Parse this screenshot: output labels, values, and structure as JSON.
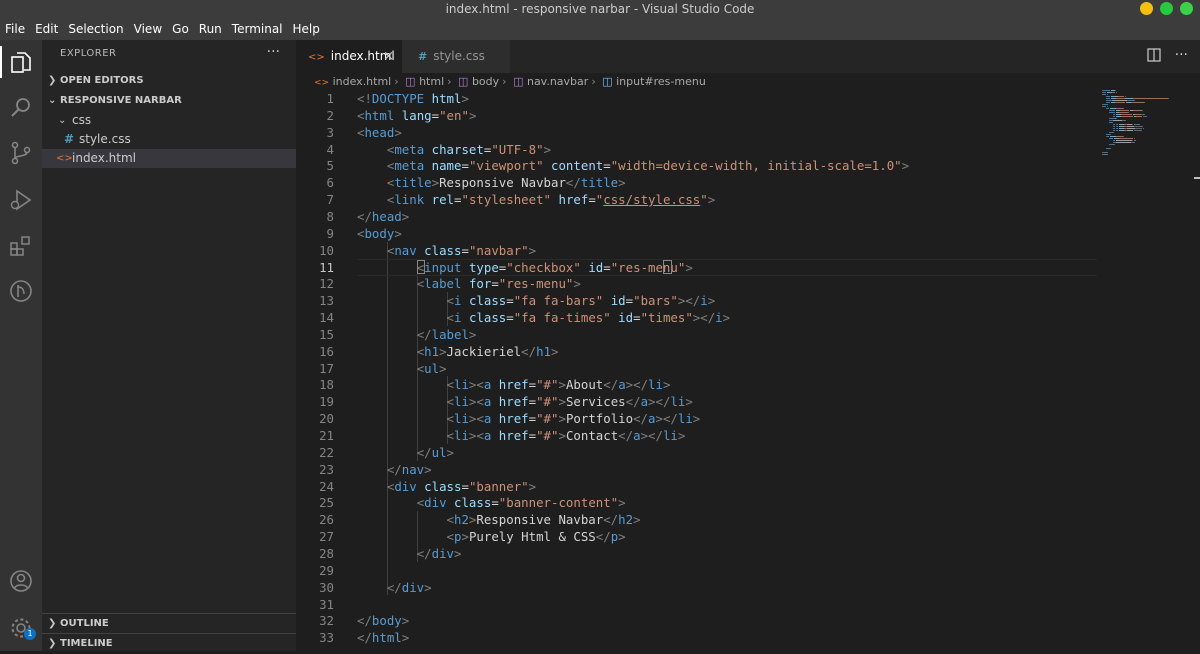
{
  "window": {
    "title": "index.html - responsive narbar - Visual Studio Code"
  },
  "menu": [
    "File",
    "Edit",
    "Selection",
    "View",
    "Go",
    "Run",
    "Terminal",
    "Help"
  ],
  "activity_icons": [
    "explorer-icon",
    "search-icon",
    "source-control-icon",
    "run-debug-icon",
    "extensions-icon",
    "remote-icon",
    "account-icon",
    "settings-gear-icon"
  ],
  "settings_badge": "1",
  "sidebar": {
    "header": "EXPLORER",
    "more": "···",
    "open_editors": "OPEN EDITORS",
    "project": "RESPONSIVE NARBAR",
    "folder": "css",
    "files": [
      "style.css",
      "index.html"
    ],
    "file_icons": [
      "#",
      "<>"
    ],
    "outline": "OUTLINE",
    "timeline": "TIMELINE"
  },
  "tabs": [
    {
      "label": "index.html",
      "icon": "<>",
      "active": true,
      "close": "×"
    },
    {
      "label": "style.css",
      "icon": "#",
      "active": false
    }
  ],
  "breadcrumbs": [
    "index.html",
    "html",
    "body",
    "nav.navbar",
    "input#res-menu"
  ],
  "editor": {
    "active_line": 11,
    "lines": [
      [
        [
          "p",
          "<!"
        ],
        [
          "t",
          "DOCTYPE"
        ],
        [
          "x",
          " "
        ],
        [
          "a",
          "html"
        ],
        [
          "p",
          ">"
        ]
      ],
      [
        [
          "p",
          "<"
        ],
        [
          "t",
          "html"
        ],
        [
          "x",
          " "
        ],
        [
          "a",
          "lang"
        ],
        [
          "x",
          "="
        ],
        [
          "s",
          "\"en\""
        ],
        [
          "p",
          ">"
        ]
      ],
      [
        [
          "p",
          "<"
        ],
        [
          "t",
          "head"
        ],
        [
          "p",
          ">"
        ]
      ],
      [
        [
          "x",
          "    "
        ],
        [
          "p",
          "<"
        ],
        [
          "t",
          "meta"
        ],
        [
          "x",
          " "
        ],
        [
          "a",
          "charset"
        ],
        [
          "x",
          "="
        ],
        [
          "s",
          "\"UTF-8\""
        ],
        [
          "p",
          ">"
        ]
      ],
      [
        [
          "x",
          "    "
        ],
        [
          "p",
          "<"
        ],
        [
          "t",
          "meta"
        ],
        [
          "x",
          " "
        ],
        [
          "a",
          "name"
        ],
        [
          "x",
          "="
        ],
        [
          "s",
          "\"viewport\""
        ],
        [
          "x",
          " "
        ],
        [
          "a",
          "content"
        ],
        [
          "x",
          "="
        ],
        [
          "s",
          "\"width=device-width, initial-scale=1.0\""
        ],
        [
          "p",
          ">"
        ]
      ],
      [
        [
          "x",
          "    "
        ],
        [
          "p",
          "<"
        ],
        [
          "t",
          "title"
        ],
        [
          "p",
          ">"
        ],
        [
          "x",
          "Responsive Navbar"
        ],
        [
          "p",
          "</"
        ],
        [
          "t",
          "title"
        ],
        [
          "p",
          ">"
        ]
      ],
      [
        [
          "x",
          "    "
        ],
        [
          "p",
          "<"
        ],
        [
          "t",
          "link"
        ],
        [
          "x",
          " "
        ],
        [
          "a",
          "rel"
        ],
        [
          "x",
          "="
        ],
        [
          "s",
          "\"stylesheet\""
        ],
        [
          "x",
          " "
        ],
        [
          "a",
          "href"
        ],
        [
          "x",
          "="
        ],
        [
          "s",
          "\""
        ],
        [
          "l",
          "css/style.css"
        ],
        [
          "s",
          "\""
        ],
        [
          "p",
          ">"
        ]
      ],
      [
        [
          "p",
          "</"
        ],
        [
          "t",
          "head"
        ],
        [
          "p",
          ">"
        ]
      ],
      [
        [
          "p",
          "<"
        ],
        [
          "t",
          "body"
        ],
        [
          "p",
          ">"
        ]
      ],
      [
        [
          "x",
          "    "
        ],
        [
          "p",
          "<"
        ],
        [
          "t",
          "nav"
        ],
        [
          "x",
          " "
        ],
        [
          "a",
          "class"
        ],
        [
          "x",
          "="
        ],
        [
          "s",
          "\"navbar\""
        ],
        [
          "p",
          ">"
        ]
      ],
      [
        [
          "x",
          "        "
        ],
        [
          "p",
          "<"
        ],
        [
          "t",
          "input"
        ],
        [
          "x",
          " "
        ],
        [
          "a",
          "type"
        ],
        [
          "x",
          "="
        ],
        [
          "s",
          "\"checkbox\""
        ],
        [
          "x",
          " "
        ],
        [
          "a",
          "id"
        ],
        [
          "x",
          "="
        ],
        [
          "s",
          "\"res-menu\""
        ],
        [
          "p",
          ">"
        ]
      ],
      [
        [
          "x",
          "        "
        ],
        [
          "p",
          "<"
        ],
        [
          "t",
          "label"
        ],
        [
          "x",
          " "
        ],
        [
          "a",
          "for"
        ],
        [
          "x",
          "="
        ],
        [
          "s",
          "\"res-menu\""
        ],
        [
          "p",
          ">"
        ]
      ],
      [
        [
          "x",
          "            "
        ],
        [
          "p",
          "<"
        ],
        [
          "t",
          "i"
        ],
        [
          "x",
          " "
        ],
        [
          "a",
          "class"
        ],
        [
          "x",
          "="
        ],
        [
          "s",
          "\"fa fa-bars\""
        ],
        [
          "x",
          " "
        ],
        [
          "a",
          "id"
        ],
        [
          "x",
          "="
        ],
        [
          "s",
          "\"bars\""
        ],
        [
          "p",
          "></"
        ],
        [
          "t",
          "i"
        ],
        [
          "p",
          ">"
        ]
      ],
      [
        [
          "x",
          "            "
        ],
        [
          "p",
          "<"
        ],
        [
          "t",
          "i"
        ],
        [
          "x",
          " "
        ],
        [
          "a",
          "class"
        ],
        [
          "x",
          "="
        ],
        [
          "s",
          "\"fa fa-times\""
        ],
        [
          "x",
          " "
        ],
        [
          "a",
          "id"
        ],
        [
          "x",
          "="
        ],
        [
          "s",
          "\"times\""
        ],
        [
          "p",
          "></"
        ],
        [
          "t",
          "i"
        ],
        [
          "p",
          ">"
        ]
      ],
      [
        [
          "x",
          "        "
        ],
        [
          "p",
          "</"
        ],
        [
          "t",
          "label"
        ],
        [
          "p",
          ">"
        ]
      ],
      [
        [
          "x",
          "        "
        ],
        [
          "p",
          "<"
        ],
        [
          "t",
          "h1"
        ],
        [
          "p",
          ">"
        ],
        [
          "x",
          "Jackieriel"
        ],
        [
          "p",
          "</"
        ],
        [
          "t",
          "h1"
        ],
        [
          "p",
          ">"
        ]
      ],
      [
        [
          "x",
          "        "
        ],
        [
          "p",
          "<"
        ],
        [
          "t",
          "ul"
        ],
        [
          "p",
          ">"
        ]
      ],
      [
        [
          "x",
          "            "
        ],
        [
          "p",
          "<"
        ],
        [
          "t",
          "li"
        ],
        [
          "p",
          "><"
        ],
        [
          "t",
          "a"
        ],
        [
          "x",
          " "
        ],
        [
          "a",
          "href"
        ],
        [
          "x",
          "="
        ],
        [
          "s",
          "\"#\""
        ],
        [
          "p",
          ">"
        ],
        [
          "x",
          "About"
        ],
        [
          "p",
          "</"
        ],
        [
          "t",
          "a"
        ],
        [
          "p",
          "></"
        ],
        [
          "t",
          "li"
        ],
        [
          "p",
          ">"
        ]
      ],
      [
        [
          "x",
          "            "
        ],
        [
          "p",
          "<"
        ],
        [
          "t",
          "li"
        ],
        [
          "p",
          "><"
        ],
        [
          "t",
          "a"
        ],
        [
          "x",
          " "
        ],
        [
          "a",
          "href"
        ],
        [
          "x",
          "="
        ],
        [
          "s",
          "\"#\""
        ],
        [
          "p",
          ">"
        ],
        [
          "x",
          "Services"
        ],
        [
          "p",
          "</"
        ],
        [
          "t",
          "a"
        ],
        [
          "p",
          "></"
        ],
        [
          "t",
          "li"
        ],
        [
          "p",
          ">"
        ]
      ],
      [
        [
          "x",
          "            "
        ],
        [
          "p",
          "<"
        ],
        [
          "t",
          "li"
        ],
        [
          "p",
          "><"
        ],
        [
          "t",
          "a"
        ],
        [
          "x",
          " "
        ],
        [
          "a",
          "href"
        ],
        [
          "x",
          "="
        ],
        [
          "s",
          "\"#\""
        ],
        [
          "p",
          ">"
        ],
        [
          "x",
          "Portfolio"
        ],
        [
          "p",
          "</"
        ],
        [
          "t",
          "a"
        ],
        [
          "p",
          "></"
        ],
        [
          "t",
          "li"
        ],
        [
          "p",
          ">"
        ]
      ],
      [
        [
          "x",
          "            "
        ],
        [
          "p",
          "<"
        ],
        [
          "t",
          "li"
        ],
        [
          "p",
          "><"
        ],
        [
          "t",
          "a"
        ],
        [
          "x",
          " "
        ],
        [
          "a",
          "href"
        ],
        [
          "x",
          "="
        ],
        [
          "s",
          "\"#\""
        ],
        [
          "p",
          ">"
        ],
        [
          "x",
          "Contact"
        ],
        [
          "p",
          "</"
        ],
        [
          "t",
          "a"
        ],
        [
          "p",
          "></"
        ],
        [
          "t",
          "li"
        ],
        [
          "p",
          ">"
        ]
      ],
      [
        [
          "x",
          "        "
        ],
        [
          "p",
          "</"
        ],
        [
          "t",
          "ul"
        ],
        [
          "p",
          ">"
        ]
      ],
      [
        [
          "x",
          "    "
        ],
        [
          "p",
          "</"
        ],
        [
          "t",
          "nav"
        ],
        [
          "p",
          ">"
        ]
      ],
      [
        [
          "x",
          "    "
        ],
        [
          "p",
          "<"
        ],
        [
          "t",
          "div"
        ],
        [
          "x",
          " "
        ],
        [
          "a",
          "class"
        ],
        [
          "x",
          "="
        ],
        [
          "s",
          "\"banner\""
        ],
        [
          "p",
          ">"
        ]
      ],
      [
        [
          "x",
          "        "
        ],
        [
          "p",
          "<"
        ],
        [
          "t",
          "div"
        ],
        [
          "x",
          " "
        ],
        [
          "a",
          "class"
        ],
        [
          "x",
          "="
        ],
        [
          "s",
          "\"banner-content\""
        ],
        [
          "p",
          ">"
        ]
      ],
      [
        [
          "x",
          "            "
        ],
        [
          "p",
          "<"
        ],
        [
          "t",
          "h2"
        ],
        [
          "p",
          ">"
        ],
        [
          "x",
          "Responsive Navbar"
        ],
        [
          "p",
          "</"
        ],
        [
          "t",
          "h2"
        ],
        [
          "p",
          ">"
        ]
      ],
      [
        [
          "x",
          "            "
        ],
        [
          "p",
          "<"
        ],
        [
          "t",
          "p"
        ],
        [
          "p",
          ">"
        ],
        [
          "x",
          "Purely Html & CSS"
        ],
        [
          "p",
          "</"
        ],
        [
          "t",
          "p"
        ],
        [
          "p",
          ">"
        ]
      ],
      [
        [
          "x",
          "        "
        ],
        [
          "p",
          "</"
        ],
        [
          "t",
          "div"
        ],
        [
          "p",
          ">"
        ]
      ],
      [],
      [
        [
          "x",
          "    "
        ],
        [
          "p",
          "</"
        ],
        [
          "t",
          "div"
        ],
        [
          "p",
          ">"
        ]
      ],
      [],
      [
        [
          "p",
          "</"
        ],
        [
          "t",
          "body"
        ],
        [
          "p",
          ">"
        ]
      ],
      [
        [
          "p",
          "</"
        ],
        [
          "t",
          "html"
        ],
        [
          "p",
          ">"
        ]
      ]
    ]
  },
  "colors": {
    "punct": "#808080",
    "tag": "#569cd6",
    "attr": "#9cdcfe",
    "string": "#ce9178",
    "text": "#d4d4d4",
    "traffic_yellow": "#f5bf0f",
    "traffic_green": "#27c93f",
    "traffic_green2": "#3bd24a"
  }
}
